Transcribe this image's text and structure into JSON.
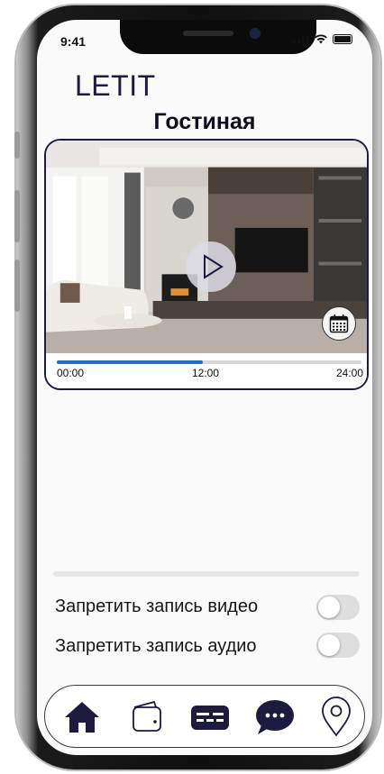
{
  "status_bar": {
    "time": "9:41"
  },
  "app": {
    "brand": "LETIT",
    "room_title": "Гостиная"
  },
  "player": {
    "state": "paused",
    "progress_fraction": 0.48,
    "time_labels": [
      "00:00",
      "12:00",
      "24:00"
    ]
  },
  "settings": [
    {
      "label": "Запретить запись видео",
      "enabled": false
    },
    {
      "label": "Запретить запись аудио",
      "enabled": false
    }
  ],
  "tabbar": {
    "items": [
      "home-icon",
      "wallet-icon",
      "card-icon",
      "chat-icon",
      "location-icon"
    ],
    "active": "home-icon"
  },
  "colors": {
    "brand_navy": "#1c1a3e",
    "progress_blue": "#1f6fcf",
    "toggle_off": "#dedede"
  }
}
